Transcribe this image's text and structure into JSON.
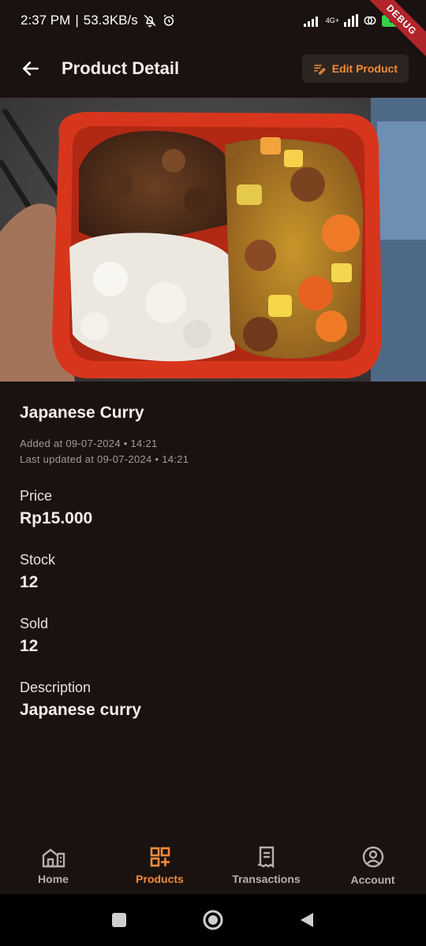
{
  "status_bar": {
    "time": "2:37 PM",
    "separator": "|",
    "speed": "53.3KB/s",
    "network": "4G+",
    "battery": "88",
    "debug_label": "DEBUG"
  },
  "app_bar": {
    "title": "Product Detail",
    "edit_label": "Edit Product"
  },
  "product": {
    "name": "Japanese Curry",
    "added": "Added at 09-07-2024 • 14:21",
    "updated": "Last updated at 09-07-2024 • 14:21",
    "price_label": "Price",
    "price_value": "Rp15.000",
    "stock_label": "Stock",
    "stock_value": "12",
    "sold_label": "Sold",
    "sold_value": "12",
    "description_label": "Description",
    "description_value": "Japanese curry"
  },
  "bottom_nav": {
    "items": [
      {
        "label": "Home",
        "icon": "home-icon",
        "active": false
      },
      {
        "label": "Products",
        "icon": "products-icon",
        "active": true
      },
      {
        "label": "Transactions",
        "icon": "receipt-icon",
        "active": false
      },
      {
        "label": "Account",
        "icon": "account-icon",
        "active": false
      }
    ]
  },
  "colors": {
    "accent": "#f08c3c",
    "background": "#1a1210",
    "text": "#f5efe9",
    "muted": "#a29a94"
  }
}
